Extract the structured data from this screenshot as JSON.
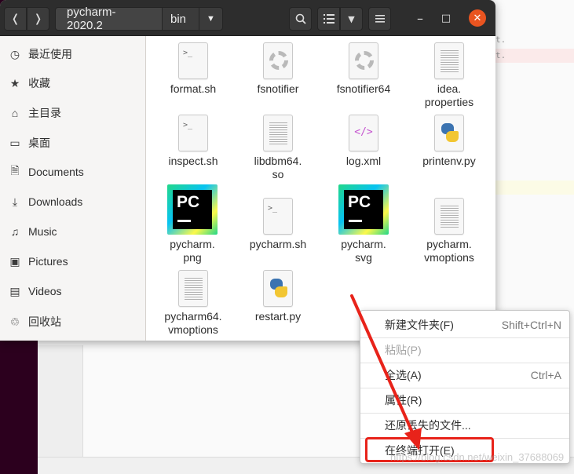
{
  "window": {
    "path": [
      "pycharm-2020.2",
      "bin"
    ]
  },
  "headerbar": {
    "back_icon": "chevron-left-icon",
    "forward_icon": "chevron-right-icon",
    "search_icon": "search-icon",
    "view_icon": "list-view-icon",
    "menu_icon": "hamburger-menu-icon"
  },
  "sidebar": {
    "items": [
      {
        "label": "最近使用",
        "icon": "clock-icon"
      },
      {
        "label": "收藏",
        "icon": "star-icon"
      },
      {
        "label": "主目录",
        "icon": "home-icon"
      },
      {
        "label": "桌面",
        "icon": "desktop-icon"
      },
      {
        "label": "Documents",
        "icon": "document-icon"
      },
      {
        "label": "Downloads",
        "icon": "download-icon"
      },
      {
        "label": "Music",
        "icon": "music-icon"
      },
      {
        "label": "Pictures",
        "icon": "picture-icon"
      },
      {
        "label": "Videos",
        "icon": "video-icon"
      },
      {
        "label": "回收站",
        "icon": "trash-icon"
      }
    ]
  },
  "files": [
    {
      "line1": "format.sh",
      "line2": "",
      "icon": "terminal-script-icon"
    },
    {
      "line1": "fsnotifier",
      "line2": "",
      "icon": "executable-icon"
    },
    {
      "line1": "fsnotifier64",
      "line2": "",
      "icon": "executable-icon"
    },
    {
      "line1": "idea.",
      "line2": "properties",
      "icon": "text-file-icon"
    },
    {
      "line1": "inspect.sh",
      "line2": "",
      "icon": "terminal-script-icon"
    },
    {
      "line1": "libdbm64.",
      "line2": "so",
      "icon": "text-file-icon"
    },
    {
      "line1": "log.xml",
      "line2": "",
      "icon": "xml-file-icon"
    },
    {
      "line1": "printenv.py",
      "line2": "",
      "icon": "python-file-icon"
    },
    {
      "line1": "pycharm.",
      "line2": "png",
      "icon": "pycharm-logo-icon",
      "logo_text": "PC"
    },
    {
      "line1": "pycharm.sh",
      "line2": "",
      "icon": "terminal-script-icon"
    },
    {
      "line1": "pycharm.",
      "line2": "svg",
      "icon": "pycharm-logo-icon",
      "logo_text": "PC"
    },
    {
      "line1": "pycharm.",
      "line2": "vmoptions",
      "icon": "text-file-icon"
    },
    {
      "line1": "pycharm64.",
      "line2": "vmoptions",
      "icon": "text-file-icon"
    },
    {
      "line1": "restart.py",
      "line2": "",
      "icon": "python-file-icon"
    }
  ],
  "context_menu": {
    "items": [
      {
        "label": "新建文件夹(F)",
        "shortcut": "Shift+Ctrl+N",
        "enabled": true
      },
      {
        "label": "粘贴(P)",
        "shortcut": "",
        "enabled": false
      },
      {
        "label": "全选(A)",
        "shortcut": "Ctrl+A",
        "enabled": true
      },
      {
        "label": "属性(R)",
        "shortcut": "",
        "enabled": true
      },
      {
        "label": "还原丢失的文件...",
        "shortcut": "",
        "enabled": true
      },
      {
        "label": "在终端打开(E)",
        "shortcut": "",
        "enabled": true
      }
    ]
  },
  "annotation": {
    "color": "#e8231a",
    "watermark": "https://blog.csdn.net/weixin_37688069"
  },
  "background_editor": {
    "fragments": [
      "t.",
      "t."
    ]
  },
  "colors": {
    "accent": "#e95420",
    "headerbar": "#2d2d2d",
    "desktop": "#2c001e"
  }
}
